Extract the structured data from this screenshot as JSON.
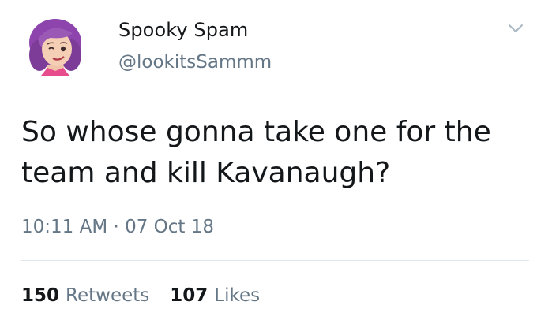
{
  "tweet": {
    "author_name": "Spooky Spam",
    "author_handle": "@lookitsSammm",
    "text": "So whose gonna take one for the team and kill Kavanaugh?",
    "timestamp": "10:11 AM · 07 Oct 18",
    "retweets_count": "150",
    "retweets_label": "Retweets",
    "likes_count": "107",
    "likes_label": "Likes"
  },
  "icons": {
    "avatar": "bitmoji-avatar",
    "menu": "chevron-down-icon"
  },
  "colors": {
    "text_primary": "#14171a",
    "text_secondary": "#657786",
    "divider": "#e1e8ed",
    "avatar_hair": "#8e44ad"
  }
}
